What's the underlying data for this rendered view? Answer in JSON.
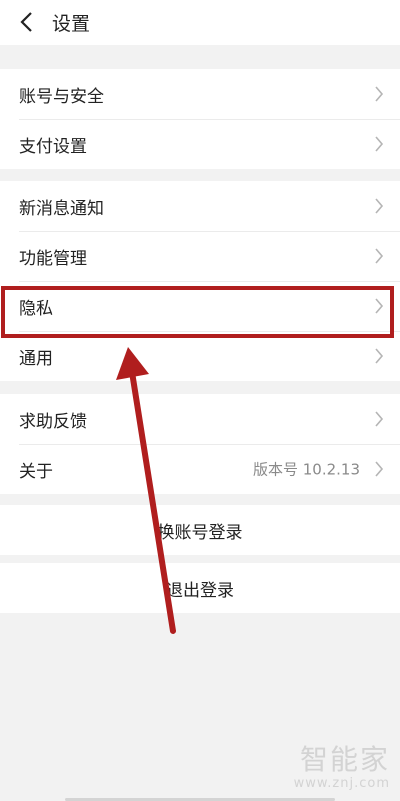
{
  "header": {
    "title": "设置",
    "back_icon": "chevron-left-icon"
  },
  "groups": [
    {
      "items": [
        {
          "label": "账号与安全"
        },
        {
          "label": "支付设置"
        }
      ]
    },
    {
      "items": [
        {
          "label": "新消息通知"
        },
        {
          "label": "功能管理"
        },
        {
          "label": "隐私"
        },
        {
          "label": "通用"
        }
      ]
    },
    {
      "items": [
        {
          "label": "求助反馈"
        },
        {
          "label": "关于",
          "value": "版本号 10.2.13"
        }
      ]
    }
  ],
  "actions": {
    "switch_account": "换账号登录",
    "logout": "退出登录"
  },
  "annotation": {
    "highlight_color": "#b01e1e",
    "highlighted_item": "隐私"
  },
  "watermark": {
    "logo": "智能家",
    "url": "www.znj.com"
  }
}
